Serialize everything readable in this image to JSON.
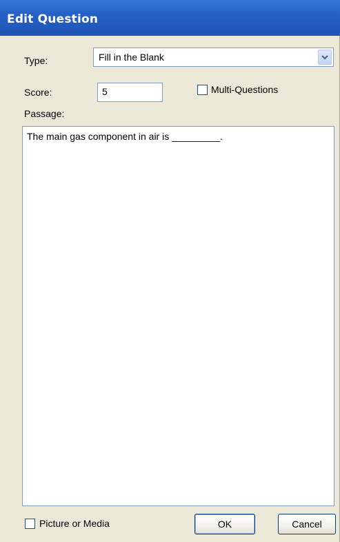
{
  "window": {
    "title": "Edit Question"
  },
  "form": {
    "type_label": "Type:",
    "type_value": "Fill in the Blank",
    "score_label": "Score:",
    "score_value": "5",
    "multi_questions_label": "Multi-Questions",
    "multi_questions_checked": false,
    "passage_label": "Passage:",
    "passage_text": "The main gas component in air is _________."
  },
  "footer": {
    "picture_media_label": "Picture or Media",
    "picture_media_checked": false,
    "ok_label": "OK",
    "cancel_label": "Cancel"
  },
  "icons": {
    "dropdown": "chevron-down-icon"
  },
  "colors": {
    "titlebar": "#2560c4",
    "dialog_bg": "#ece9d8",
    "field_border": "#7f9db9",
    "button_border": "#003c74"
  }
}
